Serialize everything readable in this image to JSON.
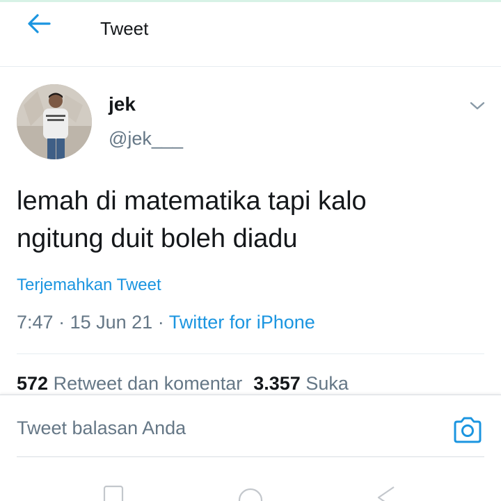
{
  "header": {
    "title": "Tweet",
    "back_icon": "arrow-left-icon",
    "accent_color": "#1b95e0"
  },
  "tweet": {
    "name": "jek",
    "handle": "@jek___",
    "text_lines": [
      "lemah di matematika tapi kalo",
      "ngitung duit boleh diadu"
    ],
    "translate_label": "Terjemahkan Tweet",
    "time": "7:47",
    "date": "15 Jun 21",
    "source": "Twitter for iPhone",
    "separator": "·"
  },
  "stats": {
    "retweets_count": "572",
    "retweets_label": "Retweet dan komentar",
    "likes_count": "3.357",
    "likes_label": "Suka"
  },
  "composer": {
    "placeholder": "Tweet balasan Anda",
    "icon": "camera-icon"
  },
  "navbar": {
    "icons": [
      "recent-apps-icon",
      "home-icon",
      "back-triangle-icon"
    ]
  }
}
